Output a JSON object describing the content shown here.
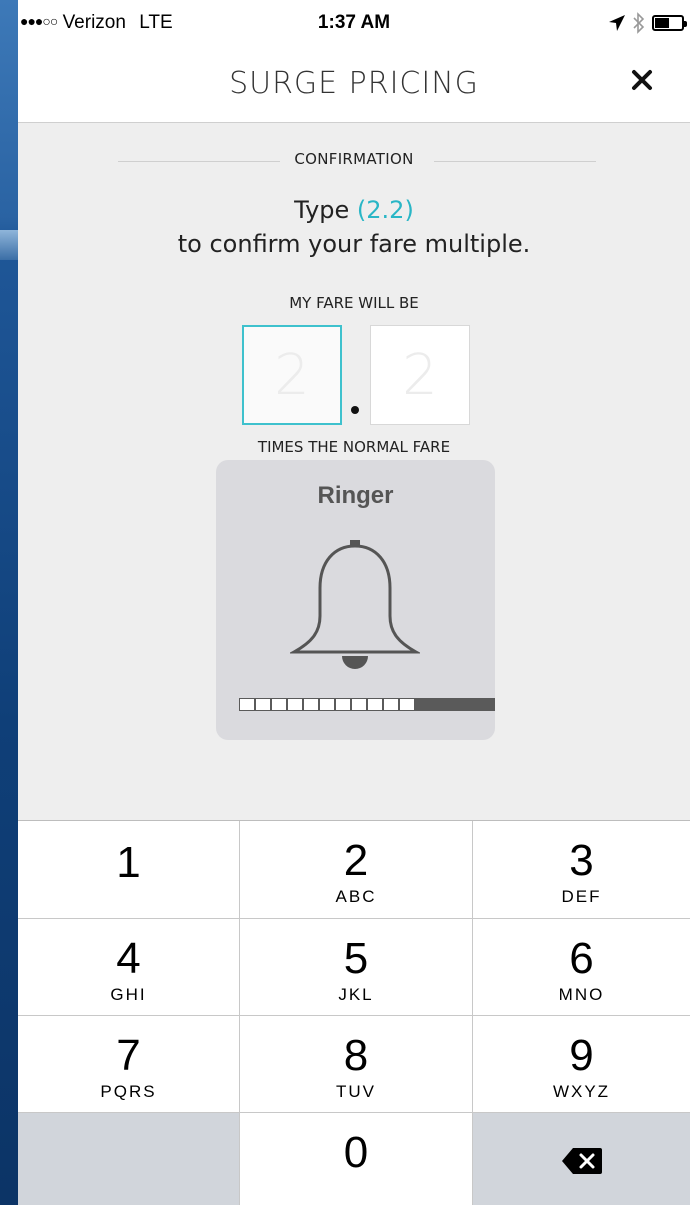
{
  "status_bar": {
    "signal": "●●●○○",
    "carrier": "Verizon",
    "network": "LTE",
    "time": "1:37 AM",
    "icons": [
      "location-arrow-icon",
      "bluetooth-icon",
      "battery-icon"
    ]
  },
  "header": {
    "title": "SURGE PRICING",
    "close_icon": "close-icon"
  },
  "confirmation": {
    "section_label": "CONFIRMATION",
    "instruction_prefix": "Type",
    "multiplier": "(2.2)",
    "instruction_suffix": "to confirm your fare multiple.",
    "fare_label": "MY FARE WILL BE",
    "digit_placeholders": [
      "2",
      "2"
    ],
    "times_label": "TIMES THE NORMAL FARE",
    "accent_color": "#29b6c6"
  },
  "ringer_hud": {
    "title": "Ringer",
    "icon": "bell-icon",
    "volume_level": 0.69
  },
  "keypad": {
    "keys": [
      {
        "num": "1",
        "letters": ""
      },
      {
        "num": "2",
        "letters": "ABC"
      },
      {
        "num": "3",
        "letters": "DEF"
      },
      {
        "num": "4",
        "letters": "GHI"
      },
      {
        "num": "5",
        "letters": "JKL"
      },
      {
        "num": "6",
        "letters": "MNO"
      },
      {
        "num": "7",
        "letters": "PQRS"
      },
      {
        "num": "8",
        "letters": "TUV"
      },
      {
        "num": "9",
        "letters": "WXYZ"
      },
      {
        "num": "0",
        "letters": ""
      }
    ],
    "backspace_icon": "backspace-icon"
  }
}
